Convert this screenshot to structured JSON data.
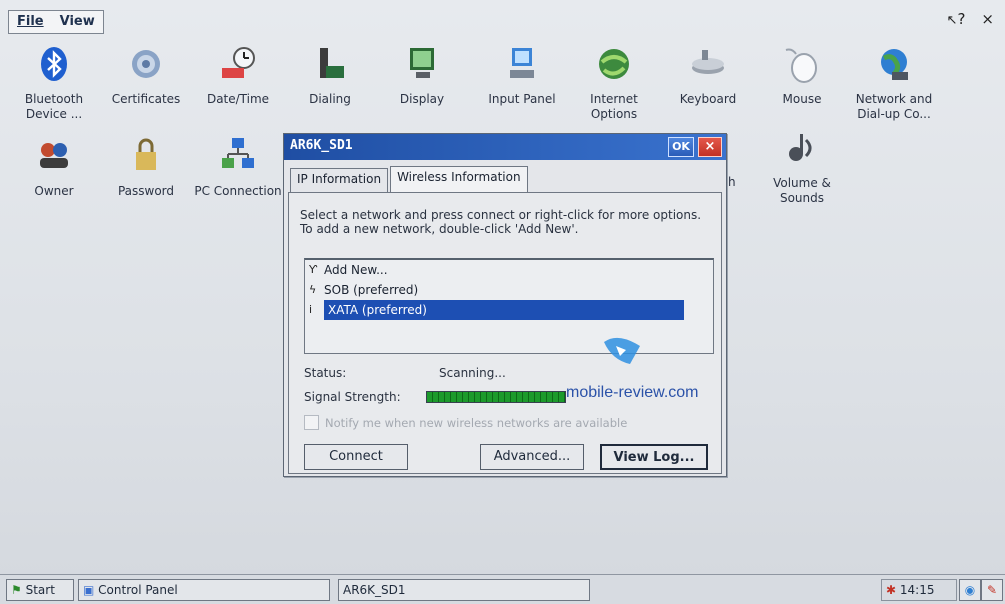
{
  "menu": {
    "file": "File",
    "view": "View"
  },
  "topright": {
    "help": "?",
    "close": "×"
  },
  "icons_row1": [
    {
      "label": "Bluetooth Device ...",
      "icon": "bluetooth-icon"
    },
    {
      "label": "Certificates",
      "icon": "certificates-icon"
    },
    {
      "label": "Date/Time",
      "icon": "clock-icon"
    },
    {
      "label": "Dialing",
      "icon": "phone-icon"
    },
    {
      "label": "Display",
      "icon": "display-icon"
    },
    {
      "label": "Input Panel",
      "icon": "input-panel-icon"
    },
    {
      "label": "Internet Options",
      "icon": "globe-icon"
    },
    {
      "label": "Keyboard",
      "icon": "keyboard-icon"
    },
    {
      "label": "Mouse",
      "icon": "mouse-icon"
    },
    {
      "label": "Network and Dial-up Co...",
      "icon": "network-icon"
    }
  ],
  "icons_row2": [
    {
      "label": "Owner",
      "icon": "owner-icon"
    },
    {
      "label": "Password",
      "icon": "password-icon"
    },
    {
      "label": "PC Connection",
      "icon": "pc-connection-icon"
    },
    {
      "label": "Volume & Sounds",
      "icon": "volume-icon"
    }
  ],
  "row2_partial_label": "h",
  "dialog": {
    "title": "AR6K_SD1",
    "ok": "OK",
    "close": "×",
    "tabs": [
      "IP Information",
      "Wireless Information"
    ],
    "instructions": "Select a network and press connect or right-click for more options.  To add a new network, double-click 'Add New'.",
    "networks": [
      {
        "label": "Add New...",
        "icon": "antenna-icon",
        "selected": false
      },
      {
        "label": "SOB (preferred)",
        "icon": "disconnected-icon",
        "selected": false
      },
      {
        "label": "XATA (preferred)",
        "icon": "info-icon",
        "selected": true
      }
    ],
    "status_label": "Status:",
    "status_value": "Scanning...",
    "signal_label": "Signal Strength:",
    "signal_level": 1.0,
    "watermark": "mobile-review.com",
    "notify_label": "Notify me when new wireless networks are available",
    "buttons": {
      "connect": "Connect",
      "advanced": "Advanced...",
      "viewlog": "View Log..."
    }
  },
  "taskbar": {
    "start": "Start",
    "control_panel": "Control Panel",
    "task": "AR6K_SD1",
    "time": "14:15"
  }
}
